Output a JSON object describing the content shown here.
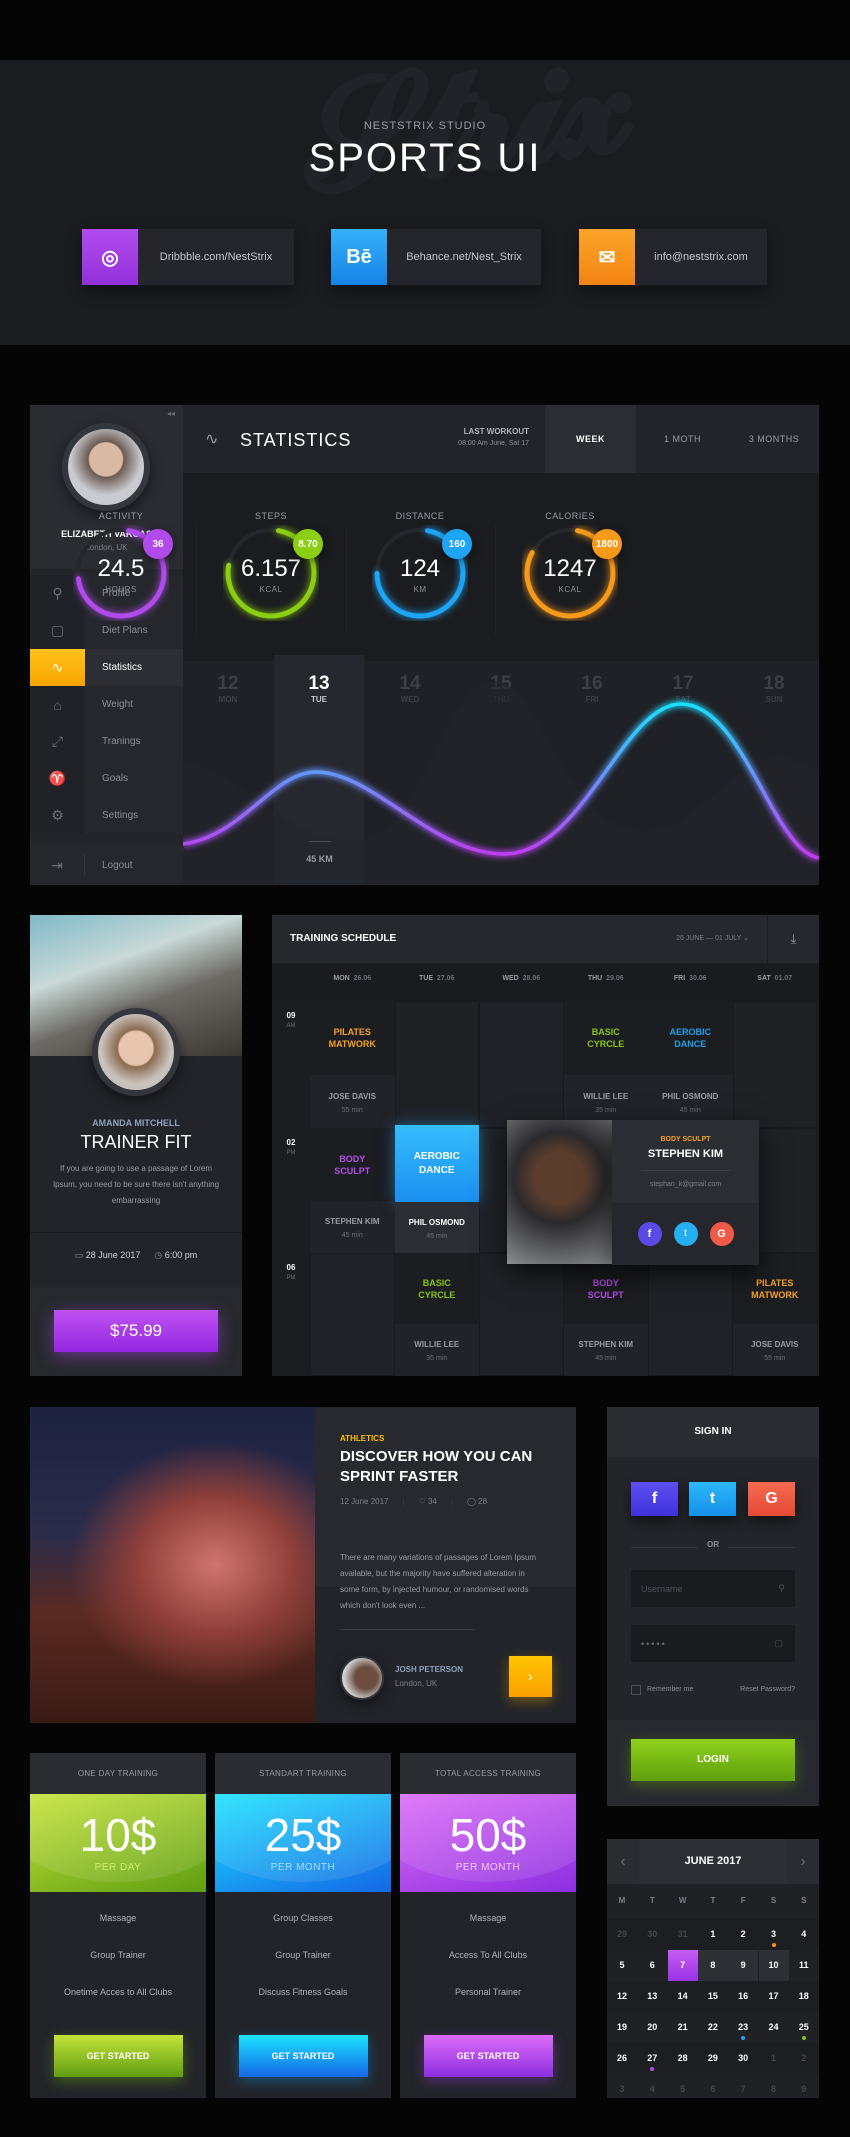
{
  "hero": {
    "studio": "NESTSTRIX STUDIO",
    "title": "SPORTS UI",
    "links": [
      {
        "icon": "dribbble-icon",
        "text": "Dribbble.com/NestStrix",
        "color": "#a43de6"
      },
      {
        "icon": "behance-icon",
        "glyph": "Bē",
        "text": "Behance.net/Nest_Strix",
        "color": "#1e9cf0"
      },
      {
        "icon": "mail-icon",
        "glyph": "✉",
        "text": "info@neststrix.com",
        "color": "#f7951d"
      }
    ]
  },
  "dashboard": {
    "user": {
      "name": "ELIZABETH VARGAS",
      "location": "London, UK"
    },
    "nav": [
      {
        "label": "Profile",
        "icon": "user-icon",
        "glyph": "⚲"
      },
      {
        "label": "Diet Plans",
        "icon": "calendar-icon",
        "glyph": "▢"
      },
      {
        "label": "Statistics",
        "icon": "pulse-icon",
        "glyph": "∿",
        "active": true
      },
      {
        "label": "Weight",
        "icon": "weight-icon",
        "glyph": "⌂"
      },
      {
        "label": "Tranings",
        "icon": "dumbbell-icon",
        "glyph": "⤢"
      },
      {
        "label": "Goals",
        "icon": "trophy-icon",
        "glyph": "♈"
      },
      {
        "label": "Settings",
        "icon": "gear-icon",
        "glyph": "⚙"
      }
    ],
    "logout": "Logout",
    "title": "STATISTICS",
    "last_workout_label": "LAST WORKOUT",
    "last_workout_time": "08:00 Am June, Sat 17",
    "tabs": [
      "WEEK",
      "1 MOTH",
      "3 MONTHS"
    ],
    "rings": [
      {
        "label": "ACTIVITY",
        "value": "24.5",
        "unit": "HOURS",
        "badge": "36",
        "color": "#b04aea",
        "progress": 0.7
      },
      {
        "label": "STEPS",
        "value": "6.157",
        "unit": "KCAL",
        "badge": "8.70",
        "color": "#8ccf12",
        "progress": 0.75
      },
      {
        "label": "DISTANCE",
        "value": "124",
        "unit": "KM",
        "badge": "160",
        "color": "#1ea5f5",
        "progress": 0.72
      },
      {
        "label": "CALORIES",
        "value": "1247",
        "unit": "KCAL",
        "badge": "1800",
        "color": "#f79a1a",
        "progress": 0.8
      }
    ],
    "days": [
      {
        "n": "12",
        "d": "MON"
      },
      {
        "n": "13",
        "d": "TUE",
        "active": true
      },
      {
        "n": "14",
        "d": "WED"
      },
      {
        "n": "15",
        "d": "THU"
      },
      {
        "n": "16",
        "d": "FRI"
      },
      {
        "n": "17",
        "d": "SAT"
      },
      {
        "n": "18",
        "d": "SUN"
      }
    ],
    "active_distance": "45 KM"
  },
  "trainer": {
    "name": "AMANDA MITCHELL",
    "title": "TRAINER FIT",
    "desc": "If you are going to use a passage of Lorem Ipsum, you need to be sure there isn't anything embarrassing",
    "date": "28 June 2017",
    "time": "6:00 pm",
    "price": "$75.99"
  },
  "schedule": {
    "title": "TRAINING SCHEDULE",
    "range": "26 JUNE — 01 JULY",
    "days": [
      {
        "d": "MON",
        "date": "26.06"
      },
      {
        "d": "TUE",
        "date": "27.06"
      },
      {
        "d": "WED",
        "date": "28.06"
      },
      {
        "d": "THU",
        "date": "29.06"
      },
      {
        "d": "FRI",
        "date": "30.06"
      },
      {
        "d": "SAT",
        "date": "01.07"
      }
    ],
    "rows": [
      {
        "hour": "09",
        "ampm": "AM",
        "items": [
          {
            "day": 0,
            "cls": "PILATES MATWORK",
            "color": "#f7a21b",
            "trainer": "JOSE DAVIS",
            "dur": "55 min"
          },
          {
            "day": 3,
            "cls": "BASIC CYRCLE",
            "color": "#8cc414",
            "trainer": "WILLIE LEE",
            "dur": "35 min"
          },
          {
            "day": 4,
            "cls": "AEROBIC DANCE",
            "color": "#1ea0e8",
            "trainer": "PHIL OSMOND",
            "dur": "45 min"
          }
        ]
      },
      {
        "hour": "02",
        "ampm": "PM",
        "items": [
          {
            "day": 0,
            "cls": "BODY SCULPT",
            "color": "#b44de8",
            "trainer": "STEPHEN KIM",
            "dur": "45 min"
          },
          {
            "day": 1,
            "cls": "AEROBIC DANCE",
            "color": "#ffffff",
            "trainer": "PHIL OSMOND",
            "dur": "45 min",
            "active": true
          }
        ]
      },
      {
        "hour": "06",
        "ampm": "PM",
        "items": [
          {
            "day": 1,
            "cls": "BASIC CYRCLE",
            "color": "#8cc414",
            "trainer": "WILLIE LEE",
            "dur": "35 min"
          },
          {
            "day": 3,
            "cls": "BODY SCULPT",
            "color": "#b44de8",
            "trainer": "STEPHEN KIM",
            "dur": "45 min"
          },
          {
            "day": 5,
            "cls": "PILATES MATWORK",
            "color": "#f7a21b",
            "trainer": "JOSE DAVIS",
            "dur": "55 min"
          }
        ]
      }
    ],
    "popup": {
      "cls": "BODY SCULPT",
      "name": "STEPHEN KIM",
      "email": "stephan_k@gmail.com"
    }
  },
  "article": {
    "category": "ATHLETICS",
    "title": "DISCOVER HOW YOU CAN SPRINT FASTER",
    "date": "12 June 2017",
    "likes": "34",
    "comments": "28",
    "body": "There are many variations of passages of Lorem Ipsum available, but the majority have suffered alteration in some form, by injected humour, or randomised words which don't look even ...",
    "author": "JOSH PETERSON",
    "author_loc": "London, UK"
  },
  "signin": {
    "title": "SIGN IN",
    "or": "OR",
    "username_placeholder": "Username",
    "password_value": "•••••",
    "remember": "Remember me",
    "reset": "Reset Password?",
    "login": "LOGIN"
  },
  "pricing": [
    {
      "title": "ONE DAY TRAINING",
      "price": "10$",
      "per": "PER DAY",
      "features": [
        "Massage",
        "Group Trainer",
        "Onetime Acces to All Clubs"
      ],
      "cta": "GET STARTED",
      "color": "#7cc414"
    },
    {
      "title": "STANDART TRAINING",
      "price": "25$",
      "per": "PER MONTH",
      "features": [
        "Group Classes",
        "Group Trainer",
        "Discuss Fitness Goals"
      ],
      "cta": "GET STARTED",
      "color": "#1ea0f5"
    },
    {
      "title": "TOTAL ACCESS TRAINING",
      "price": "50$",
      "per": "PER MONTH",
      "features": [
        "Massage",
        "Access To All Clubs",
        "Personal Trainer"
      ],
      "cta": "GET STARTED",
      "color": "#a93fe8"
    }
  ],
  "calendar": {
    "month": "JUNE 2017",
    "weekdays": [
      "M",
      "T",
      "W",
      "T",
      "F",
      "S",
      "S"
    ],
    "weeks": [
      [
        "29",
        "30",
        "31",
        "1",
        "2",
        "3",
        "4"
      ],
      [
        "5",
        "6",
        "7",
        "8",
        "9",
        "10",
        "11"
      ],
      [
        "12",
        "13",
        "14",
        "15",
        "16",
        "17",
        "18"
      ],
      [
        "19",
        "20",
        "21",
        "22",
        "23",
        "24",
        "25"
      ],
      [
        "26",
        "27",
        "28",
        "29",
        "30",
        "1",
        "2"
      ],
      [
        "3",
        "4",
        "5",
        "6",
        "7",
        "8",
        "9"
      ]
    ],
    "selected": "7",
    "range": [
      "8",
      "9",
      "10"
    ],
    "dots": {
      "3": "#f7951d",
      "23": "#1ea0f5",
      "25": "#7cc414",
      "27": "#b04aea"
    }
  }
}
